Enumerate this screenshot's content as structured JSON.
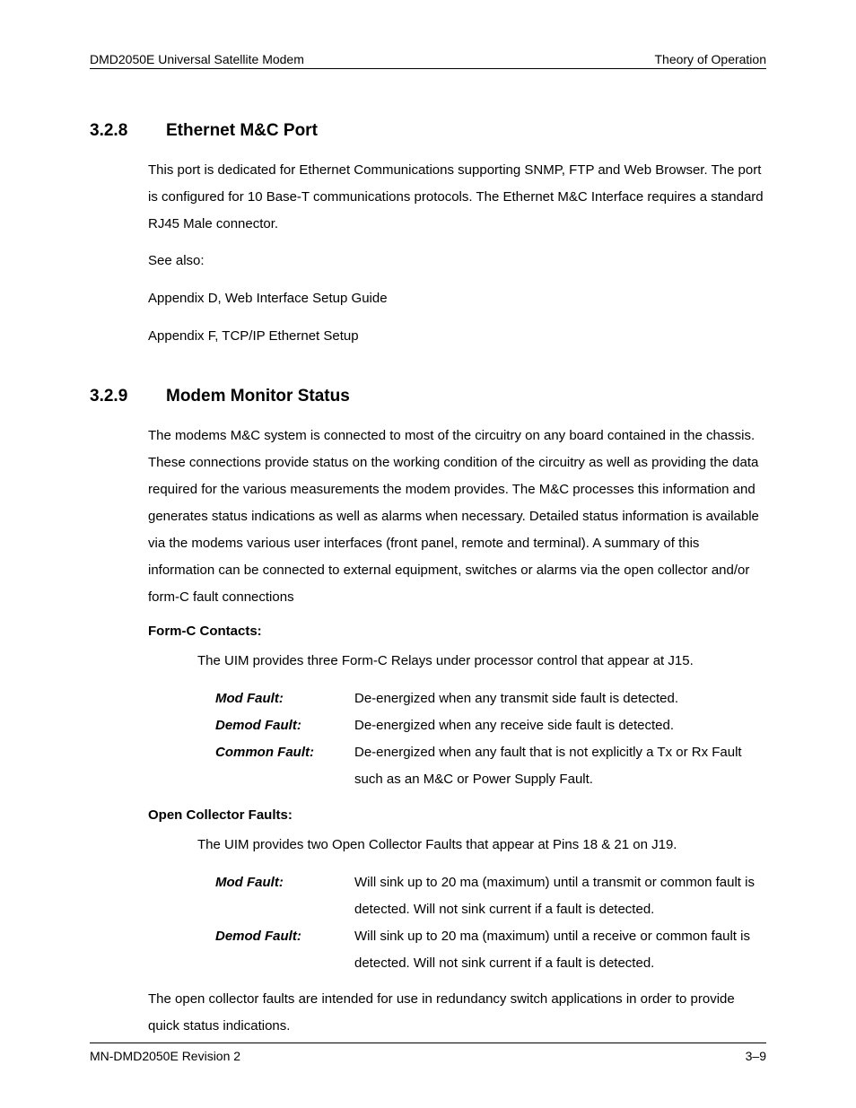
{
  "header": {
    "left": "DMD2050E Universal Satellite Modem",
    "right": "Theory of Operation"
  },
  "footer": {
    "left": "MN-DMD2050E   Revision 2",
    "right": "3–9"
  },
  "section_328": {
    "number": "3.2.8",
    "title": "Ethernet M&C Port",
    "p1": "This port is dedicated for Ethernet Communications supporting SNMP, FTP and Web Browser. The port is configured for 10 Base-T communications protocols.  The Ethernet M&C Interface requires a standard RJ45 Male connector.",
    "see_also_label": "See also:",
    "see_also_1": "Appendix D, Web Interface Setup Guide",
    "see_also_2": "Appendix F, TCP/IP Ethernet Setup"
  },
  "section_329": {
    "number": "3.2.9",
    "title": "Modem Monitor Status",
    "p1": "The modems M&C system is connected to most of the circuitry on any board contained in the chassis. These connections provide status on the working condition of the circuitry as well as providing the data required for the various measurements the modem provides. The M&C processes this information and generates status indications as well as alarms when necessary. Detailed status information is available via the modems various user interfaces (front panel, remote and terminal). A summary of this information can be connected to external equipment, switches or alarms via the open collector and/or form-C fault connections",
    "formc_heading": "Form-C Contacts:",
    "formc_intro": "The UIM provides three Form-C Relays under processor control that appear at J15.",
    "formc_items": [
      {
        "term": "Mod Fault:",
        "desc": "De-energized when any transmit side fault is detected."
      },
      {
        "term": "Demod Fault:",
        "desc": "De-energized when any receive side fault is detected."
      },
      {
        "term": "Common Fault:",
        "desc": "De-energized when any fault that is not explicitly a Tx or Rx Fault such as an M&C or Power Supply Fault."
      }
    ],
    "oc_heading": "Open Collector Faults:",
    "oc_intro": "The UIM provides two Open Collector Faults that appear at Pins 18 & 21 on J19.",
    "oc_items": [
      {
        "term": "Mod Fault:",
        "desc": "Will sink up to 20 ma (maximum) until a transmit or common fault is detected.  Will not sink current if a fault is detected."
      },
      {
        "term": "Demod Fault:",
        "desc": "Will sink up to 20 ma (maximum) until a receive or common fault is detected.  Will not sink current if a fault is detected."
      }
    ],
    "closing": "The open collector faults are intended for use in redundancy switch applications in order to provide quick status indications."
  }
}
